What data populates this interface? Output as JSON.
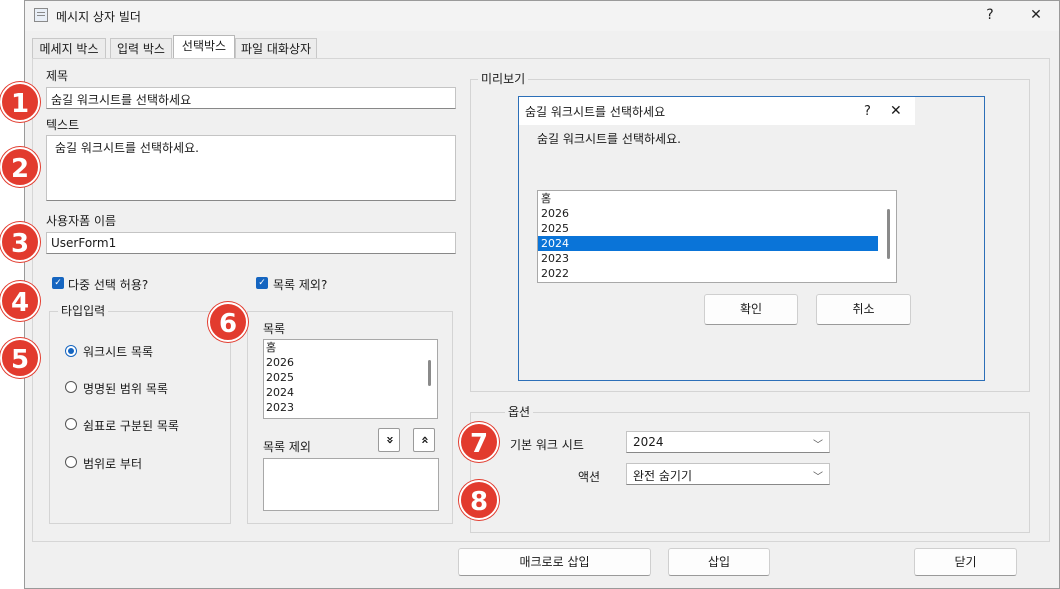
{
  "window": {
    "title": "메시지 상자 빌더",
    "help_glyph": "?",
    "close_glyph": "✕"
  },
  "tabs": [
    {
      "label": "메세지 박스",
      "active": false
    },
    {
      "label": "입력 박스",
      "active": false
    },
    {
      "label": "선택박스",
      "active": true
    },
    {
      "label": "파일 대화상자",
      "active": false
    }
  ],
  "form": {
    "title_label": "제목",
    "title_value": "숨길 워크시트를 선택하세요",
    "text_label": "텍스트",
    "text_value": "숨길 워크시트를 선택하세요.",
    "userform_label": "사용자폼 이름",
    "userform_value": "UserForm1",
    "multi_select_label": "다중 선택 허용?",
    "exclude_list_label": "목록 제외?"
  },
  "input_type": {
    "legend": "타입입력",
    "options": [
      {
        "label": "워크시트 목록",
        "selected": true
      },
      {
        "label": "명명된 범위 목록",
        "selected": false
      },
      {
        "label": "쉼표로 구분된 목록",
        "selected": false
      },
      {
        "label": "범위로 부터",
        "selected": false
      }
    ]
  },
  "list_section": {
    "list_label": "목록",
    "list_items": [
      "홈",
      "2026",
      "2025",
      "2024",
      "2023"
    ],
    "exclude_label": "목록 제외",
    "move_down_glyph": "»",
    "move_up_glyph": "«"
  },
  "preview": {
    "legend": "미리보기",
    "dialog_title": "숨길 워크시트를 선택하세요",
    "help_glyph": "?",
    "close_glyph": "✕",
    "prompt": "숨길 워크시트를 선택하세요.",
    "list_items": [
      "홈",
      "2026",
      "2025",
      "2024",
      "2023",
      "2022"
    ],
    "selected_item": "2024",
    "ok_label": "확인",
    "cancel_label": "취소"
  },
  "options": {
    "legend": "옵션",
    "default_sheet_label": "기본 워크 시트",
    "default_sheet_value": "2024",
    "action_label": "액션",
    "action_value": "완전 숨기기"
  },
  "footer": {
    "insert_macro_label": "매크로로 삽입",
    "insert_label": "삽입",
    "close_label": "닫기"
  },
  "badges": [
    "1",
    "2",
    "3",
    "4",
    "5",
    "6",
    "7",
    "8"
  ],
  "colors": {
    "accent": "#1565c0",
    "selection": "#0a74d8",
    "badge": "#e23b2e"
  }
}
